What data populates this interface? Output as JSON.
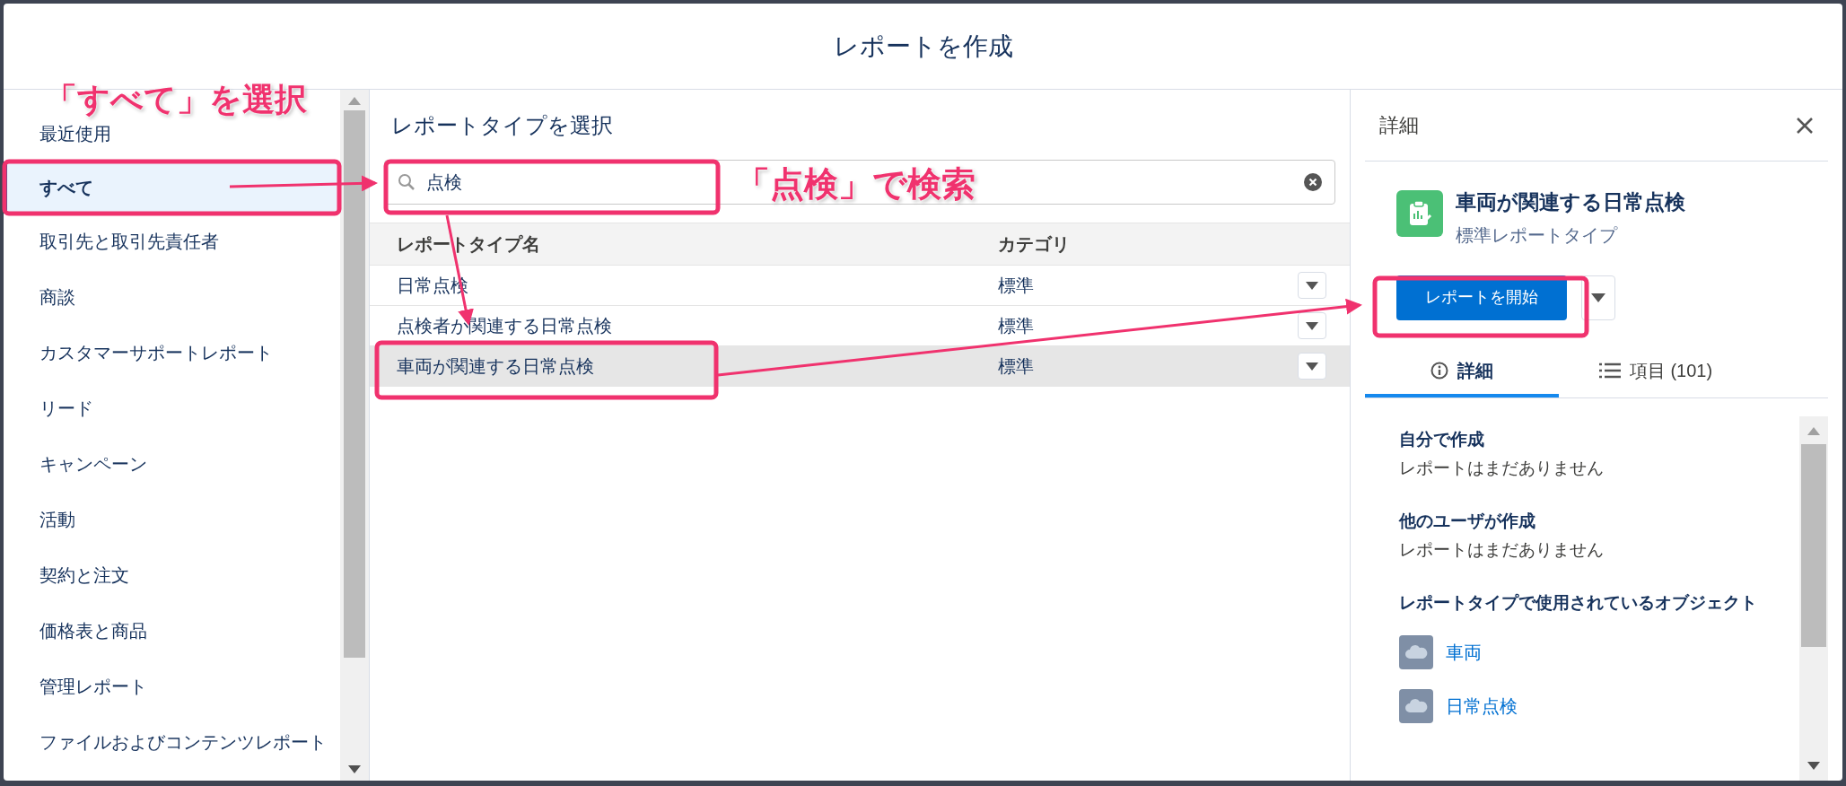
{
  "window": {
    "title": "レポートを作成"
  },
  "sidebar": {
    "items": [
      {
        "label": "最近使用",
        "selected": false
      },
      {
        "label": "すべて",
        "selected": true
      },
      {
        "label": "取引先と取引先責任者",
        "selected": false
      },
      {
        "label": "商談",
        "selected": false
      },
      {
        "label": "カスタマーサポートレポート",
        "selected": false
      },
      {
        "label": "リード",
        "selected": false
      },
      {
        "label": "キャンペーン",
        "selected": false
      },
      {
        "label": "活動",
        "selected": false
      },
      {
        "label": "契約と注文",
        "selected": false
      },
      {
        "label": "価格表と商品",
        "selected": false
      },
      {
        "label": "管理レポート",
        "selected": false
      },
      {
        "label": "ファイルおよびコンテンツレポート",
        "selected": false
      }
    ]
  },
  "main": {
    "title": "レポートタイプを選択",
    "search": {
      "value": "点検"
    },
    "table": {
      "columns": [
        "レポートタイプ名",
        "カテゴリ"
      ],
      "rows": [
        {
          "cells": [
            "日常点検",
            "標準"
          ],
          "selected": false
        },
        {
          "cells": [
            "点検者が関連する日常点検",
            "標準"
          ],
          "selected": false
        },
        {
          "cells": [
            "車両が関連する日常点検",
            "標準"
          ],
          "selected": true
        }
      ]
    }
  },
  "details": {
    "title": "詳細",
    "report_type": "車両が関連する日常点検",
    "subtitle": "標準レポートタイプ",
    "start_button": "レポートを開始",
    "tabs": [
      {
        "label": "詳細",
        "kind": "info",
        "selected": true
      },
      {
        "label": "項目 (101)",
        "kind": "list",
        "selected": false
      }
    ],
    "sections": [
      {
        "heading": "自分で作成",
        "text": "レポートはまだありません"
      },
      {
        "heading": "他のユーザが作成",
        "text": "レポートはまだありません"
      },
      {
        "heading": "レポートタイプで使用されているオブジェクト",
        "links": [
          "車両",
          "日常点検"
        ]
      }
    ]
  },
  "annotations": [
    "「すべて」を選択",
    "「点検」で検索"
  ]
}
